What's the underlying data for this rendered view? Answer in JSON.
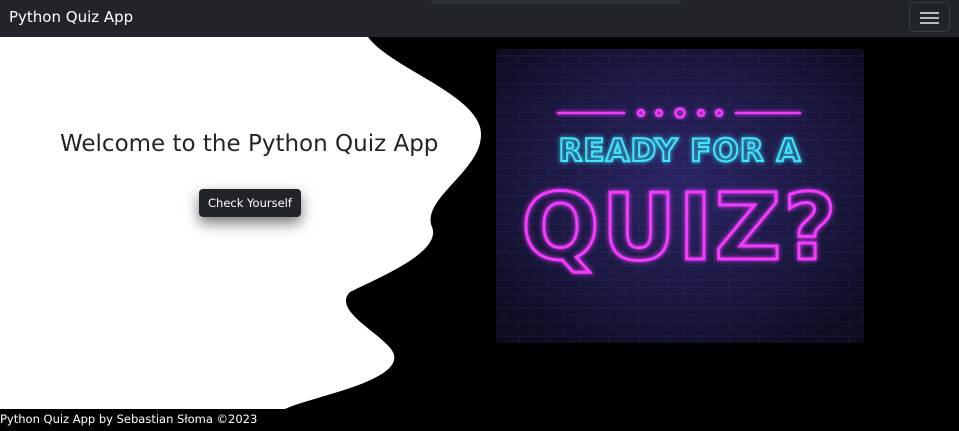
{
  "navbar": {
    "brand": "Python Quiz App"
  },
  "hero": {
    "heading": "Welcome to the Python Quiz App",
    "button_label": "Check Yourself"
  },
  "image": {
    "line1": "READY FOR A",
    "line2": "QUIZ?",
    "colors": {
      "pink": "#f23bff",
      "cyan": "#3fe6ff",
      "wall": "#1b1640"
    }
  },
  "footer": {
    "text": "Python Quiz App by Sebastian Słoma ©2023"
  },
  "icons": [
    "hamburger-menu-icon"
  ]
}
